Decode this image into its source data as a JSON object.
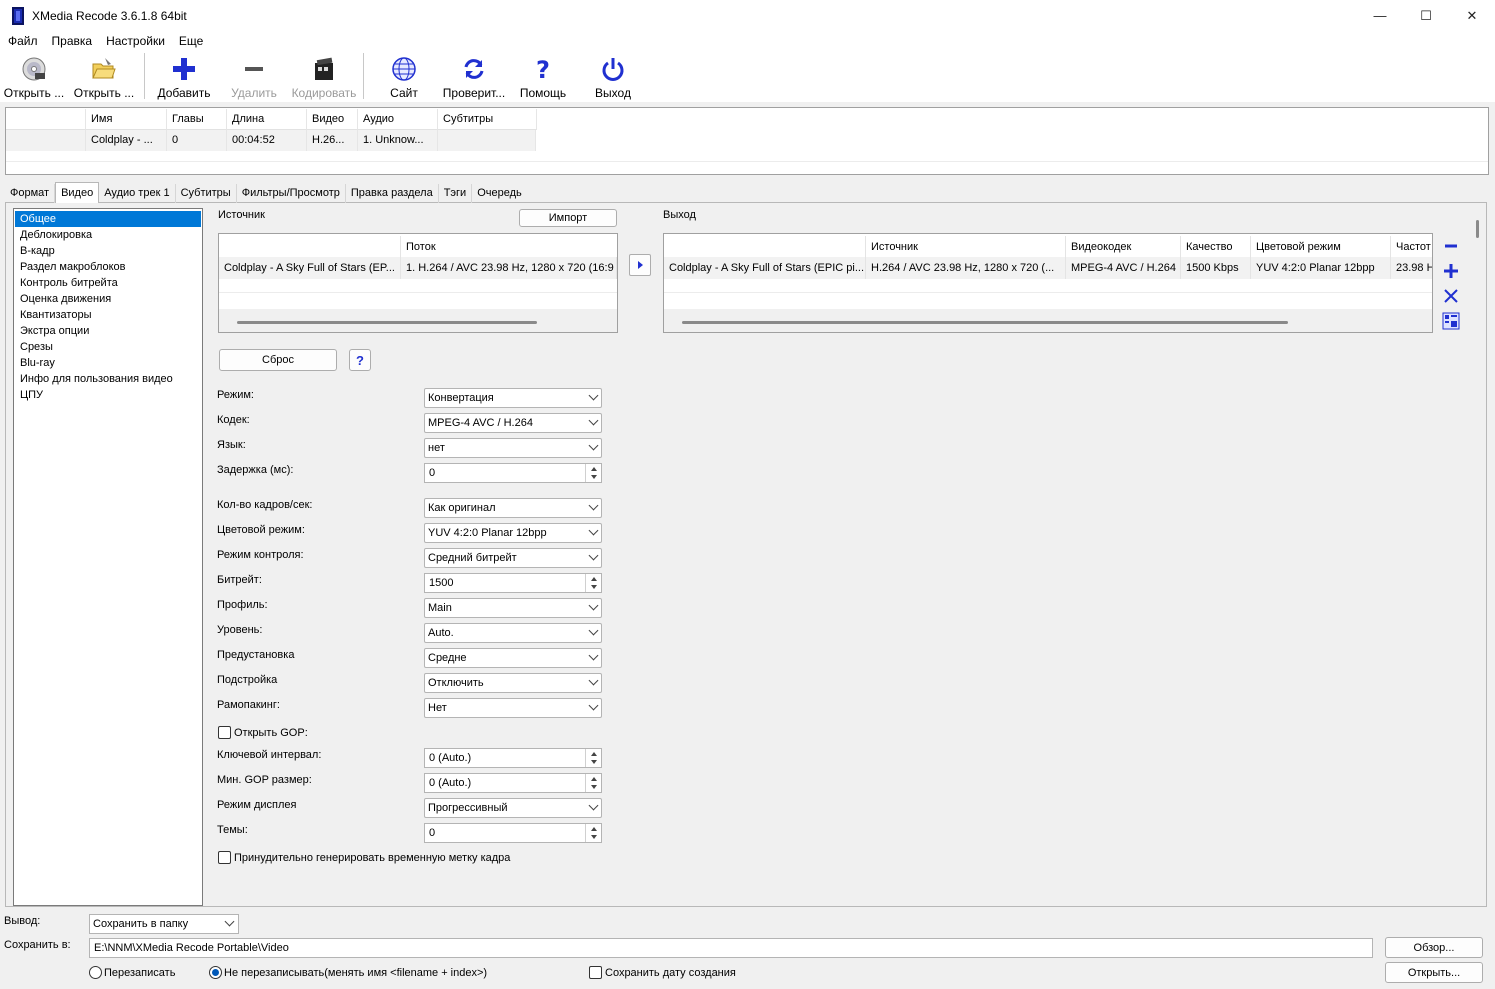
{
  "window": {
    "title": "XMedia Recode 3.6.1.8 64bit",
    "minimize": "—",
    "maximize": "☐",
    "close": "✕"
  },
  "menu": [
    "Файл",
    "Правка",
    "Настройки",
    "Еще"
  ],
  "toolbar": {
    "open_disc": "Открыть ...",
    "open_file": "Открыть ...",
    "add": "Добавить",
    "remove": "Удалить",
    "encode": "Кодировать",
    "site": "Сайт",
    "check": "Проверит...",
    "help": "Помощь",
    "exit": "Выход"
  },
  "filelist": {
    "columns": [
      "",
      "Имя",
      "Главы",
      "Длина",
      "Видео",
      "Аудио",
      "Субтитры"
    ],
    "rows": [
      [
        "",
        "Coldplay - ...",
        "0",
        "00:04:52",
        "H.26...",
        "1. Unknow...",
        ""
      ]
    ]
  },
  "tabs": [
    "Формат",
    "Видео",
    "Аудио трек 1",
    "Субтитры",
    "Фильтры/Просмотр",
    "Правка раздела",
    "Тэги",
    "Очередь"
  ],
  "nav": [
    "Общее",
    "Деблокировка",
    "B-кадр",
    "Раздел макроблоков",
    "Контроль битрейта",
    "Оценка движения",
    "Квантизаторы",
    "Экстра опции",
    "Срезы",
    "Blu-ray",
    "Инфо для пользования видео",
    "ЦПУ"
  ],
  "source": {
    "label": "Источник",
    "import_button": "Импорт",
    "columns": [
      "",
      "Поток"
    ],
    "rows": [
      [
        "Coldplay - A Sky Full of Stars (EP...",
        "1. H.264 / AVC  23.98 Hz, 1280 x 720 (16:9"
      ]
    ]
  },
  "output": {
    "label": "Выход",
    "columns": [
      "",
      "Источник",
      "Видеокодек",
      "Качество",
      "Цветовой режим",
      "Частот"
    ],
    "rows": [
      [
        "Coldplay - A Sky Full of Stars (EPIC pi...",
        "H.264 / AVC  23.98 Hz, 1280 x 720 (...",
        "MPEG-4 AVC / H.264",
        "1500 Kbps",
        "YUV 4:2:0 Planar 12bpp",
        "23.98 H"
      ]
    ]
  },
  "reset_button": "Сброс",
  "help_button": "?",
  "settings": {
    "mode": {
      "label": "Режим:",
      "value": "Конвертация"
    },
    "codec": {
      "label": "Кодек:",
      "value": "MPEG-4 AVC / H.264"
    },
    "language": {
      "label": "Язык:",
      "value": "нет"
    },
    "delay": {
      "label": "Задержка (мс):",
      "value": "0"
    },
    "fps": {
      "label": "Кол-во кадров/сек:",
      "value": "Как оригинал"
    },
    "color_mode": {
      "label": "Цветовой режим:",
      "value": "YUV 4:2:0 Planar 12bpp"
    },
    "rate_control": {
      "label": "Режим контроля:",
      "value": "Средний битрейт"
    },
    "bitrate": {
      "label": "Битрейт:",
      "value": "1500"
    },
    "profile": {
      "label": "Профиль:",
      "value": "Main"
    },
    "level": {
      "label": "Уровень:",
      "value": "Auto."
    },
    "preset": {
      "label": "Предустановка",
      "value": "Средне"
    },
    "tune": {
      "label": "Подстройка",
      "value": "Отключить"
    },
    "frame_packing": {
      "label": "Рамопакинг:",
      "value": "Нет"
    },
    "open_gop": {
      "label": "Открыть GOP:"
    },
    "keyint": {
      "label": "Ключевой интервал:",
      "value": "0 (Auto.)"
    },
    "min_gop": {
      "label": "Мин. GOP размер:",
      "value": "0 (Auto.)"
    },
    "display_mode": {
      "label": "Режим дисплея",
      "value": "Прогрессивный"
    },
    "threads": {
      "label": "Темы:",
      "value": "0"
    },
    "force_timestamp": {
      "label": "Принудительно генерировать временную метку кадра"
    }
  },
  "bottom": {
    "output_label": "Вывод:",
    "output_value": "Сохранить в папку",
    "save_label": "Сохранить в:",
    "save_path": "E:\\NNM\\XMedia Recode Portable\\Video",
    "browse_button": "Обзор...",
    "open_button": "Открыть...",
    "overwrite": "Перезаписать",
    "no_overwrite": "Не перезаписывать(менять имя <filename + index>)",
    "keep_date": "Сохранить дату создания"
  }
}
